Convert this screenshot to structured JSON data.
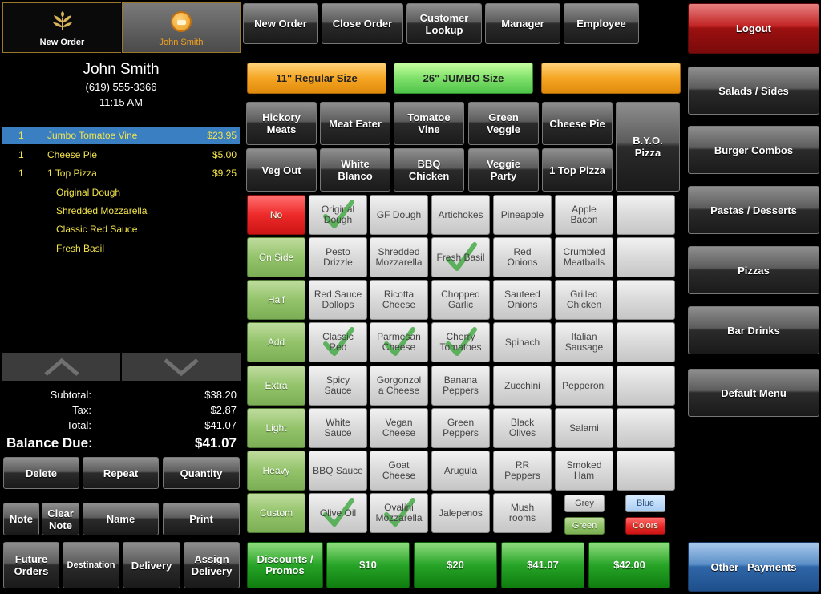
{
  "header_tabs": {
    "new_order": "New Order",
    "user_name": "John Smith"
  },
  "customer": {
    "name": "John Smith",
    "phone": "(619) 555-3366",
    "time": "11:15 AM"
  },
  "order_items": [
    {
      "qty": "1",
      "name": "Jumbo Tomatoe Vine",
      "price": "$23.95",
      "selected": true
    },
    {
      "qty": "1",
      "name": "Cheese Pie",
      "price": "$5.00"
    },
    {
      "qty": "1",
      "name": "1 Top Pizza",
      "price": "$9.25"
    }
  ],
  "modifiers": [
    "Original Dough",
    "Shredded Mozzarella",
    "Classic Red Sauce",
    "Fresh Basil"
  ],
  "totals": {
    "subtotal_label": "Subtotal:",
    "subtotal": "$38.20",
    "tax_label": "Tax:",
    "tax": "$2.87",
    "total_label": "Total:",
    "total": "$41.07",
    "balance_label": "Balance Due:",
    "balance": "$41.07"
  },
  "left_buttons": {
    "delete": "Delete",
    "repeat": "Repeat",
    "quantity": "Quantity",
    "note": "Note",
    "clear_note": "Clear\nNote",
    "name": "Name",
    "print": "Print",
    "future_orders": "Future\nOrders",
    "destination": "Destination",
    "delivery": "Delivery",
    "assign_delivery": "Assign\nDelivery"
  },
  "top_nav": {
    "new_order": "New Order",
    "close_order": "Close Order",
    "customer_lookup": "Customer\nLookup",
    "manager": "Manager",
    "employee": "Employee"
  },
  "sizes": {
    "regular": "11\" Regular Size",
    "jumbo": "26\" JUMBO Size",
    "blank": ""
  },
  "specialty_row1": [
    "Hickory\nMeats",
    "Meat Eater",
    "Tomatoe\nVine",
    "Green\nVeggie",
    "Cheese Pie"
  ],
  "specialty_row2": [
    "Veg Out",
    "White\nBlanco",
    "BBQ\nChicken",
    "Veggie\nParty",
    "1 Top Pizza"
  ],
  "byo": "B.Y.O.\nPizza",
  "modifier_types": [
    "No",
    "On Side",
    "Half",
    "Add",
    "Extra",
    "Light",
    "Heavy",
    "Custom"
  ],
  "toppings": [
    [
      {
        "t": "Original\nDough",
        "c": true
      },
      {
        "t": "GF Dough"
      },
      {
        "t": "Artichokes"
      },
      {
        "t": "Pineapple"
      },
      {
        "t": "Apple\nBacon"
      }
    ],
    [
      {
        "t": "Pesto\nDrizzle"
      },
      {
        "t": "Shredded\nMozzarella"
      },
      {
        "t": "Fresh Basil",
        "c": true
      },
      {
        "t": "Red\nOnions"
      },
      {
        "t": "Crumbled\nMeatballs"
      }
    ],
    [
      {
        "t": "Red Sauce\nDollops"
      },
      {
        "t": "Ricotta\nCheese"
      },
      {
        "t": "Chopped\nGarlic"
      },
      {
        "t": "Sauteed\nOnions"
      },
      {
        "t": "Grilled\nChicken"
      }
    ],
    [
      {
        "t": "Classic\nRed",
        "c": true
      },
      {
        "t": "Parmesan\nCheese",
        "c": true
      },
      {
        "t": "Cherry\nTomatoes",
        "c": true
      },
      {
        "t": "Spinach"
      },
      {
        "t": "Italian\nSausage"
      }
    ],
    [
      {
        "t": "Spicy\nSauce"
      },
      {
        "t": "Gorgonzol\na Cheese"
      },
      {
        "t": "Banana\nPeppers"
      },
      {
        "t": "Zucchini"
      },
      {
        "t": "Pepperoni"
      }
    ],
    [
      {
        "t": "White\nSauce"
      },
      {
        "t": "Vegan\nCheese"
      },
      {
        "t": "Green\nPeppers"
      },
      {
        "t": "Black\nOlives"
      },
      {
        "t": "Salami"
      }
    ],
    [
      {
        "t": "BBQ Sauce"
      },
      {
        "t": "Goat\nCheese"
      },
      {
        "t": "Arugula"
      },
      {
        "t": "RR\nPeppers"
      },
      {
        "t": "Smoked\nHam"
      }
    ],
    [
      {
        "t": "Olive Oil",
        "c": true
      },
      {
        "t": "Ovalini\nMozzarella",
        "c": true
      },
      {
        "t": "Jalepenos"
      },
      {
        "t": "Mush\nrooms"
      }
    ]
  ],
  "color_buttons": {
    "grey": "Grey",
    "green": "Green",
    "blue": "Blue",
    "colors": "Colors"
  },
  "payments": [
    "Discounts /\nPromos",
    "$10",
    "$20",
    "$41.07",
    "$42.00"
  ],
  "right_menu": {
    "logout": "Logout",
    "items": [
      "Salads / Sides",
      "Burger Combos",
      "Pastas / Desserts",
      "Pizzas",
      "Bar Drinks",
      "Default Menu"
    ],
    "other_payments": "Other   Payments"
  },
  "colors": {
    "accent_blue": "#3f8fd2",
    "logout_red": "#b41c1c",
    "order_text": "#f4e54a",
    "user_orange": "#f0a020"
  }
}
